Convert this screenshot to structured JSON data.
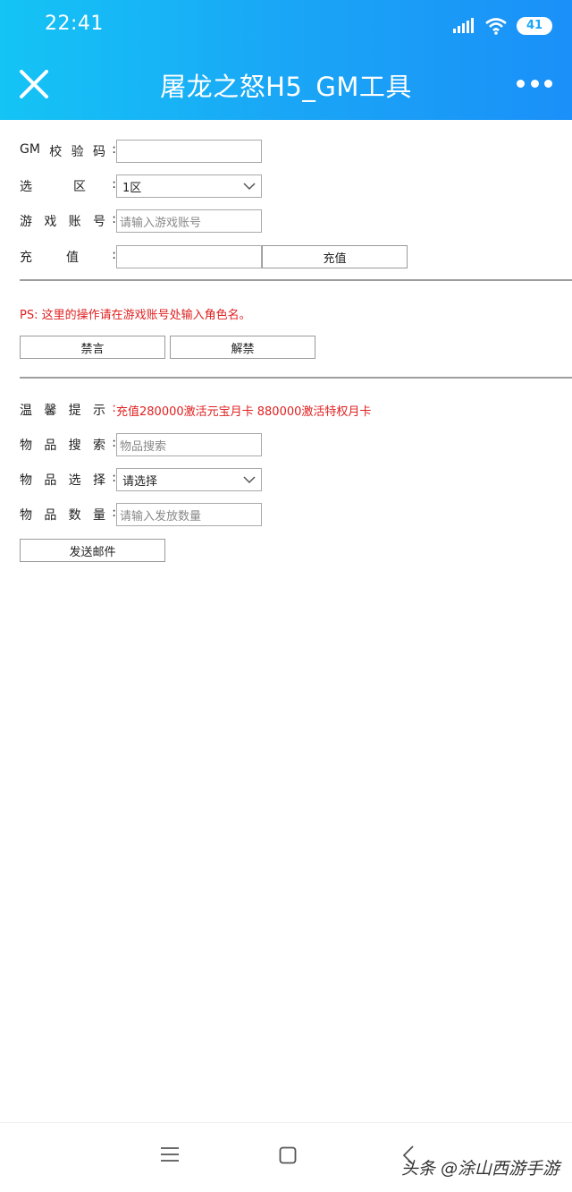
{
  "status_bar": {
    "time": "22:41",
    "battery": "41"
  },
  "header": {
    "title": "屠龙之怒H5_GM工具"
  },
  "form": {
    "gm_code": {
      "label_chars": [
        "GM",
        "校",
        "验",
        "码"
      ],
      "value": ""
    },
    "zone": {
      "label_chars": [
        "选",
        "区"
      ],
      "selected": "1区"
    },
    "account": {
      "label_chars": [
        "游",
        "戏",
        "账",
        "号"
      ],
      "placeholder": "请输入游戏账号"
    },
    "recharge": {
      "label_chars": [
        "充",
        "值"
      ],
      "value": "",
      "button": "充值"
    },
    "ps_note": "PS: 这里的操作请在游戏账号处输入角色名。",
    "mute_button": "禁言",
    "unmute_button": "解禁",
    "tip": {
      "label_chars": [
        "温",
        "馨",
        "提",
        "示"
      ],
      "text": "充值280000激活元宝月卡 880000激活特权月卡"
    },
    "item_search": {
      "label_chars": [
        "物",
        "品",
        "搜",
        "索"
      ],
      "placeholder": "物品搜索"
    },
    "item_select": {
      "label_chars": [
        "物",
        "品",
        "选",
        "择"
      ],
      "selected": "请选择"
    },
    "item_qty": {
      "label_chars": [
        "物",
        "品",
        "数",
        "量"
      ],
      "placeholder": "请输入发放数量"
    },
    "send_mail_button": "发送邮件",
    "colon": ":"
  },
  "watermark": "头条 @涂山西游手游",
  "colors": {
    "header_start": "#14c4f5",
    "header_end": "#1a90f8",
    "note_red": "#e02020"
  },
  "icons": [
    "close-icon",
    "more-icon",
    "signal-icon",
    "wifi-icon",
    "chevron-down-icon",
    "menu-icon",
    "home-icon",
    "back-icon"
  ]
}
